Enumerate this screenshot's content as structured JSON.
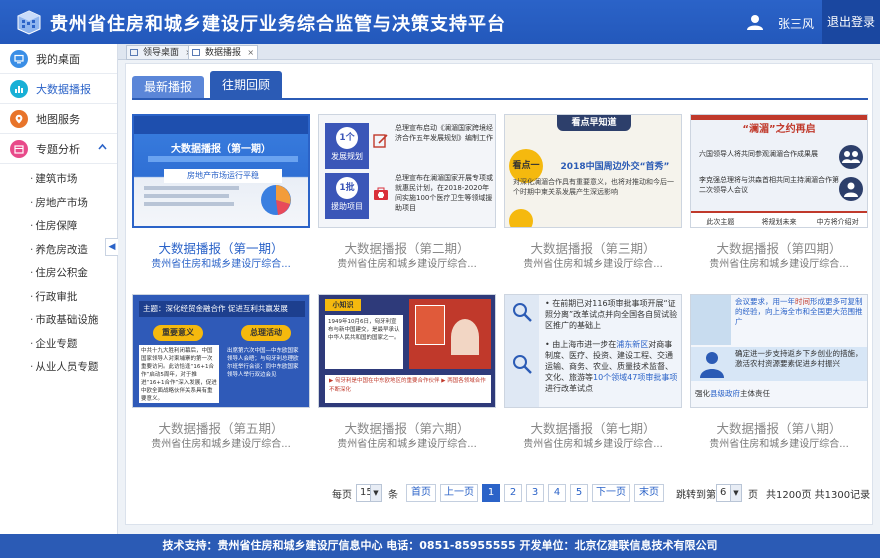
{
  "header": {
    "title": "贵州省住房和城乡建设厅业务综合监管与决策支持平台",
    "user_name": "张三风",
    "logout_label": "退出登录"
  },
  "sidebar": {
    "items": [
      {
        "label": "我的桌面",
        "icon": "monitor-icon",
        "color": "#3a8ee6"
      },
      {
        "label": "大数据播报",
        "icon": "chart-icon",
        "color": "#19b0d6"
      },
      {
        "label": "地图服务",
        "icon": "map-icon",
        "color": "#e8742a"
      },
      {
        "label": "专题分析",
        "icon": "calendar-icon",
        "color": "#e84a8a"
      }
    ],
    "sub_items": [
      "建筑市场",
      "房地产市场",
      "住房保障",
      "养危房改造",
      "住房公积金",
      "行政审批",
      "市政基础设施",
      "企业专题",
      "从业人员专题"
    ]
  },
  "page_tabs": [
    {
      "label": "领导桌面"
    },
    {
      "label": "数据播报"
    }
  ],
  "content_tabs": {
    "latest": "最新播报",
    "past": "往期回顾"
  },
  "cards": [
    {
      "title": "大数据播报（第一期）",
      "subtitle": "贵州省住房和城乡建设厅综合...",
      "thumb_heading": "大数据播报（第一期）",
      "thumb_sub": "房地产市场运行平稳"
    },
    {
      "title": "大数据播报（第二期）",
      "subtitle": "贵州省住房和城乡建设厅综合...",
      "thumb_a_badge": "1个",
      "thumb_a_label": "发展规划",
      "thumb_a_text": "总理宣布启动《澜湄国家跨境经济合作五年发展规划》编制工作",
      "thumb_b_badge": "1批",
      "thumb_b_label": "援助项目",
      "thumb_b_text": "总理宣布在澜湄国家开展专项或就惠民计划，在2018-2020年间实施100个医疗卫生等领域援助项目"
    },
    {
      "title": "大数据播报（第三期）",
      "subtitle": "贵州省住房和城乡建设厅综合...",
      "thumb_heading": "看点早知道",
      "thumb_point": "看点一",
      "thumb_headline": "2018中国周边外交“首秀”",
      "thumb_text": "对深化澜湄合作具有重要意义，也将对推动和今后一个时期中柬关系发展产生深远影响"
    },
    {
      "title": "大数据播报（第四期）",
      "subtitle": "贵州省住房和城乡建设厅综合...",
      "thumb_heading": "“澜湄”之约再启",
      "thumb_line1": "六国领导人将共同参观澜湄合作成果展",
      "thumb_line2": "李克强总理将与洪森首相共同主持澜湄合作第二次领导人会议",
      "thumb_c1": "此次主题",
      "thumb_c2": "将规划未来",
      "thumb_c3": "中方将介绍对"
    },
    {
      "title": "大数据播报（第五期）",
      "subtitle": "贵州省住房和城乡建设厅综合...",
      "thumb_heading": "主题：深化经贸金融合作 促进互利共赢发展",
      "thumb_k1": "重要意义",
      "thumb_k2": "总理活动",
      "thumb_left": "中共十九大胜利闭幕后，中国国家领导人对柬埔寨的第一次重要访问。此访恰逢“16+1合作”启动5周年，对于推进“16+1合作”深入发展，促进中欧全面战略伙伴关系具有重要意义。",
      "thumb_right": "出席第六次中国—中东欧国家领导人会晤；与匈牙利总理欧尔班举行会谈；同中东欧国家领导人举行双边会见"
    },
    {
      "title": "大数据播报（第六期）",
      "subtitle": "贵州省住房和城乡建设厅综合...",
      "thumb_tag": "小知识",
      "thumb_text": "1949年10月6日，匈牙利宣布与新中国建交，是最早承认中华人民共和国的国家之一。",
      "thumb_list": "▶ 匈牙利是中国在中东欧地区的重要合作伙伴 ▶ 两国各领域合作不断深化"
    },
    {
      "title": "大数据播报（第七期）",
      "subtitle": "贵州省住房和城乡建设厅综合...",
      "thumb_b1": "在前期已对116项审批事项开展“证照分离”改革试点并向全国各自贸试验区推广的基础上",
      "thumb_b2a": "由上海市进一步在",
      "thumb_b2hl": "浦东新区",
      "thumb_b2b": "对商事制度、医疗、投资、建设工程、交通运输、商务、农业、质量技术监督、文化、旅游等",
      "thumb_b2c": "10个领域47项审批事项",
      "thumb_b2d": "进行改革试点"
    },
    {
      "title": "大数据播报（第八期）",
      "subtitle": "贵州省住房和城乡建设厅综合...",
      "thumb_t1a": "会议要求，用一年",
      "thumb_t1hl": "时间",
      "thumb_t1b": "形成更多可复制的经验，向上海全市和全国更大范围推广",
      "thumb_t2": "确定进一步支持返乡下乡创业的措施，激活农村资源要素促进乡村振兴",
      "thumb_t3a": "强化",
      "thumb_t3hl": "县级政府",
      "thumb_t3b": "主体责任"
    }
  ],
  "pager": {
    "per_page_label": "每页",
    "per_page_value": "15",
    "items_unit": "条",
    "first": "首页",
    "prev": "上一页",
    "pages": [
      "1",
      "2",
      "3",
      "4",
      "5"
    ],
    "current_page": 1,
    "next": "下一页",
    "last": "末页",
    "jump_label": "跳转到第",
    "jump_value": "6",
    "page_unit": "页",
    "summary": "共1200页 共1300记录"
  },
  "footer": {
    "text": "技术支持：贵州省住房和城乡建设厅信息中心 电话：0851-85955555 开发单位：北京亿建联信息技术有限公司"
  },
  "colors": {
    "brand": "#2b63c8",
    "header": "#2358bb",
    "footer": "#2b5bb5"
  }
}
